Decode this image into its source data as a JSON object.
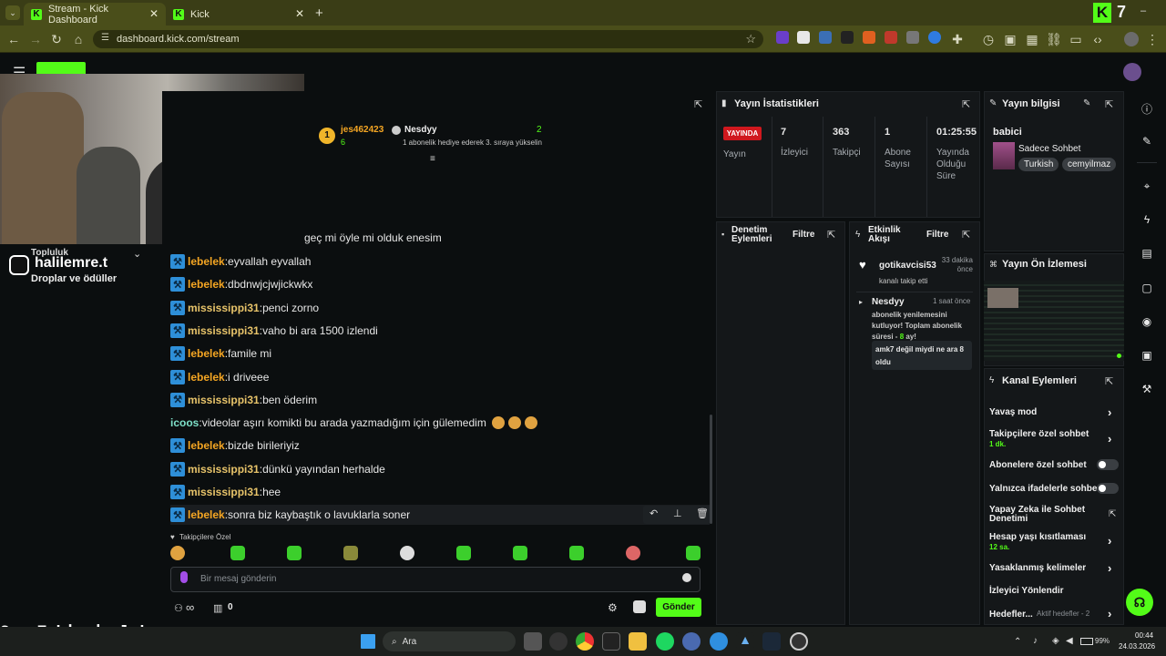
{
  "browser": {
    "tabs": [
      {
        "label": "Stream - Kick Dashboard"
      },
      {
        "label": "Kick"
      }
    ],
    "url": "dashboard.kick.com/stream",
    "corner_logo": "K",
    "corner_count": "7"
  },
  "overlay": {
    "instagram": "halilemre.t",
    "community": "Topluluk",
    "drops": "Droplar ve ödüller",
    "last_follower": "Son Takipçi: lvbyuu"
  },
  "chat": {
    "top_user": {
      "name": "jes462423",
      "count": "6",
      "rank": "1",
      "subs": "2"
    },
    "top_event": {
      "name": "Nesdyy",
      "text": "1 abonelik hediye ederek 3. sıraya yükselin"
    },
    "partial_line": "geç mi öyle mi olduk enesim",
    "messages": [
      {
        "user": "lebelek",
        "color": "#f5a623",
        "text": "eyvallah eyvallah"
      },
      {
        "user": "lebelek",
        "color": "#f5a623",
        "text": "dbdnwjcjwjickwkx"
      },
      {
        "user": "mississippi31",
        "color": "#e8c46a",
        "text": "penci zorno"
      },
      {
        "user": "mississippi31",
        "color": "#e8c46a",
        "text": "vaho bi ara 1500 izlendi"
      },
      {
        "user": "lebelek",
        "color": "#f5a623",
        "text": "famile mi"
      },
      {
        "user": "lebelek",
        "color": "#f5a623",
        "text": "i driveee"
      },
      {
        "user": "mississippi31",
        "color": "#e8c46a",
        "text": "ben öderim"
      },
      {
        "user": "icoos",
        "color": "#7ee0c8",
        "text": "videolar aşırı komikti bu arada yazmadığım için gülemedim"
      },
      {
        "user": "lebelek",
        "color": "#f5a623",
        "text": "bizde birileriyiz"
      },
      {
        "user": "mississippi31",
        "color": "#e8c46a",
        "text": "dünkü yayından herhalde"
      },
      {
        "user": "mississippi31",
        "color": "#e8c46a",
        "text": "hee"
      },
      {
        "user": "lebelek",
        "color": "#f5a623",
        "text": "sonra biz kaybaştık o lavuklarla soner"
      }
    ],
    "follower_only_label": "Takipçilere Özel",
    "input_placeholder": "Bir mesaj gönderin",
    "infinity": "∞",
    "gift_count": "0",
    "send_label": "Gönder"
  },
  "stats": {
    "title": "Yayın İstatistikleri",
    "live_badge": "YAYINDA",
    "live_label": "Yayın",
    "viewers": {
      "value": "7",
      "label": "İzleyici"
    },
    "followers": {
      "value": "363",
      "label": "Takipçi"
    },
    "subs": {
      "value": "1",
      "label": "Abone Sayısı"
    },
    "duration": {
      "value": "01:25:55",
      "label": "Yayında Olduğu Süre"
    }
  },
  "moderation": {
    "title": "Denetim Eylemleri",
    "filter": "Filtre"
  },
  "activity": {
    "title": "Etkinlik Akışı",
    "filter": "Filtre",
    "items": [
      {
        "user": "gotikavcisi53",
        "time": "33 dakika önce",
        "text": "kanalı takip etti"
      },
      {
        "user": "Nesdyy",
        "time": "1 saat önce",
        "text_a": "abonelik yenilemesini kutluyor! Toplam abonelik süresi - ",
        "months": "8",
        "text_b": " ay!",
        "quote": "amk7 değil miydi ne ara 8 oldu"
      }
    ]
  },
  "stream_info": {
    "title": "Yayın bilgisi",
    "stream_title": "babici",
    "category": "Sadece Sohbet",
    "tags": [
      "Turkish",
      "cemyilmaz"
    ]
  },
  "preview": {
    "title": "Yayın Ön İzlemesi"
  },
  "channel_actions": {
    "title": "Kanal Eylemleri",
    "slow_mode": "Yavaş mod",
    "followers_only": "Takipçilere özel sohbet",
    "followers_only_value": "1 dk.",
    "subs_only": "Abonelere özel sohbet",
    "emotes_only": "Yalnızca ifadelerle sohbet",
    "ai_mod": "Yapay Zeka ile Sohbet Denetimi",
    "age_limit": "Hesap yaşı kısıtlaması",
    "age_limit_value": "12 sa.",
    "banned_words": "Yasaklanmış kelimeler",
    "redirect": "İzleyici Yönlendir",
    "goals": "Hedefler...",
    "active_goals": "Aktif hedefler - 2"
  },
  "taskbar": {
    "search": "Ara",
    "time": "00:44",
    "date": "24.03.2026",
    "battery": "99%"
  }
}
